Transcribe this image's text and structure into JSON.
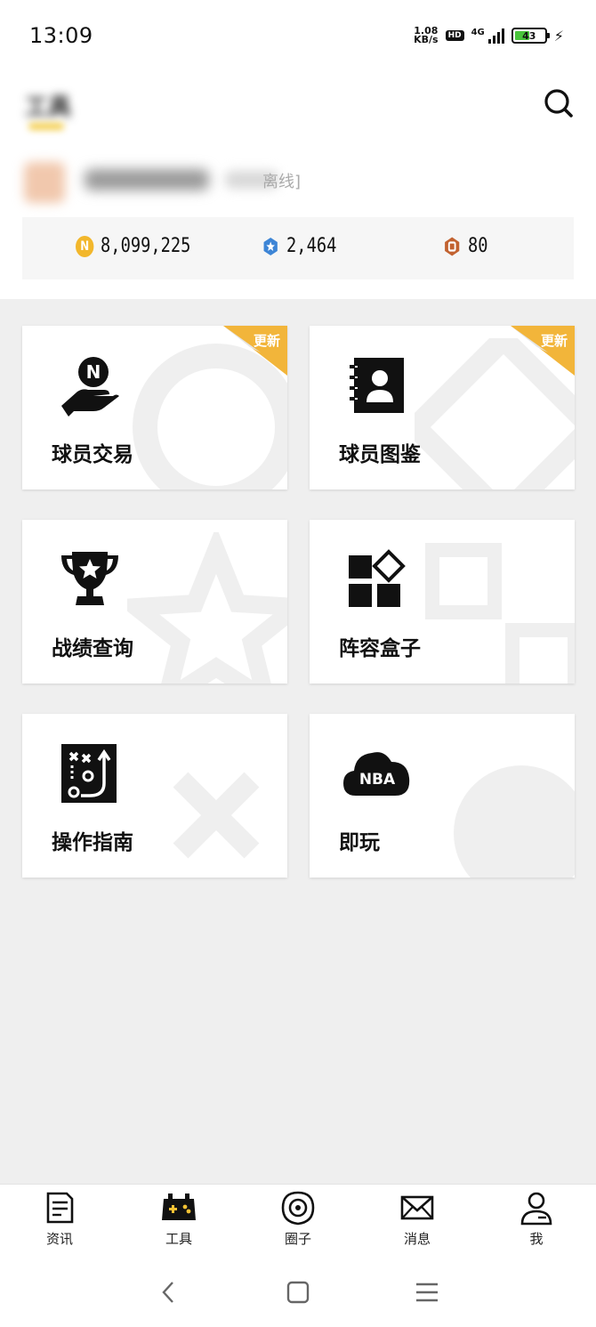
{
  "status_bar": {
    "time": "13:09",
    "net_speed_value": "1.08",
    "net_speed_unit": "KB/s",
    "hd": "HD",
    "network": "4G",
    "battery": "43",
    "charging_icon": "bolt-icon"
  },
  "header": {
    "title": "工具",
    "search_icon": "search-icon"
  },
  "profile": {
    "status": "离线]"
  },
  "currencies": [
    {
      "icon": "n-coin-icon",
      "value": "8,099,225",
      "color": "#f2b72c"
    },
    {
      "icon": "star-badge-icon",
      "value": "2,464",
      "color": "#3d85d6"
    },
    {
      "icon": "bronze-token-icon",
      "value": "80",
      "color": "#c26230"
    }
  ],
  "tools": [
    {
      "label": "球员交易",
      "icon": "hand-coin-icon",
      "badge": "更新"
    },
    {
      "label": "球员图鉴",
      "icon": "player-book-icon",
      "badge": "更新"
    },
    {
      "label": "战绩查询",
      "icon": "trophy-icon",
      "badge": ""
    },
    {
      "label": "阵容盒子",
      "icon": "lineup-box-icon",
      "badge": ""
    },
    {
      "label": "操作指南",
      "icon": "tactics-board-icon",
      "badge": ""
    },
    {
      "label": "即玩",
      "icon": "nba-cloud-icon",
      "badge": ""
    }
  ],
  "nba_cloud_text": "NBA",
  "tabs": [
    {
      "label": "资讯",
      "icon": "news-icon",
      "active": false
    },
    {
      "label": "工具",
      "icon": "gamepad-icon",
      "active": true
    },
    {
      "label": "圈子",
      "icon": "circle-icon",
      "active": false
    },
    {
      "label": "消息",
      "icon": "mail-icon",
      "active": false
    },
    {
      "label": "我",
      "icon": "user-icon",
      "active": false
    }
  ],
  "colors": {
    "badge": "#f2b53a",
    "active_tab_accent": "#f3c234",
    "page_bg": "#efefef"
  }
}
